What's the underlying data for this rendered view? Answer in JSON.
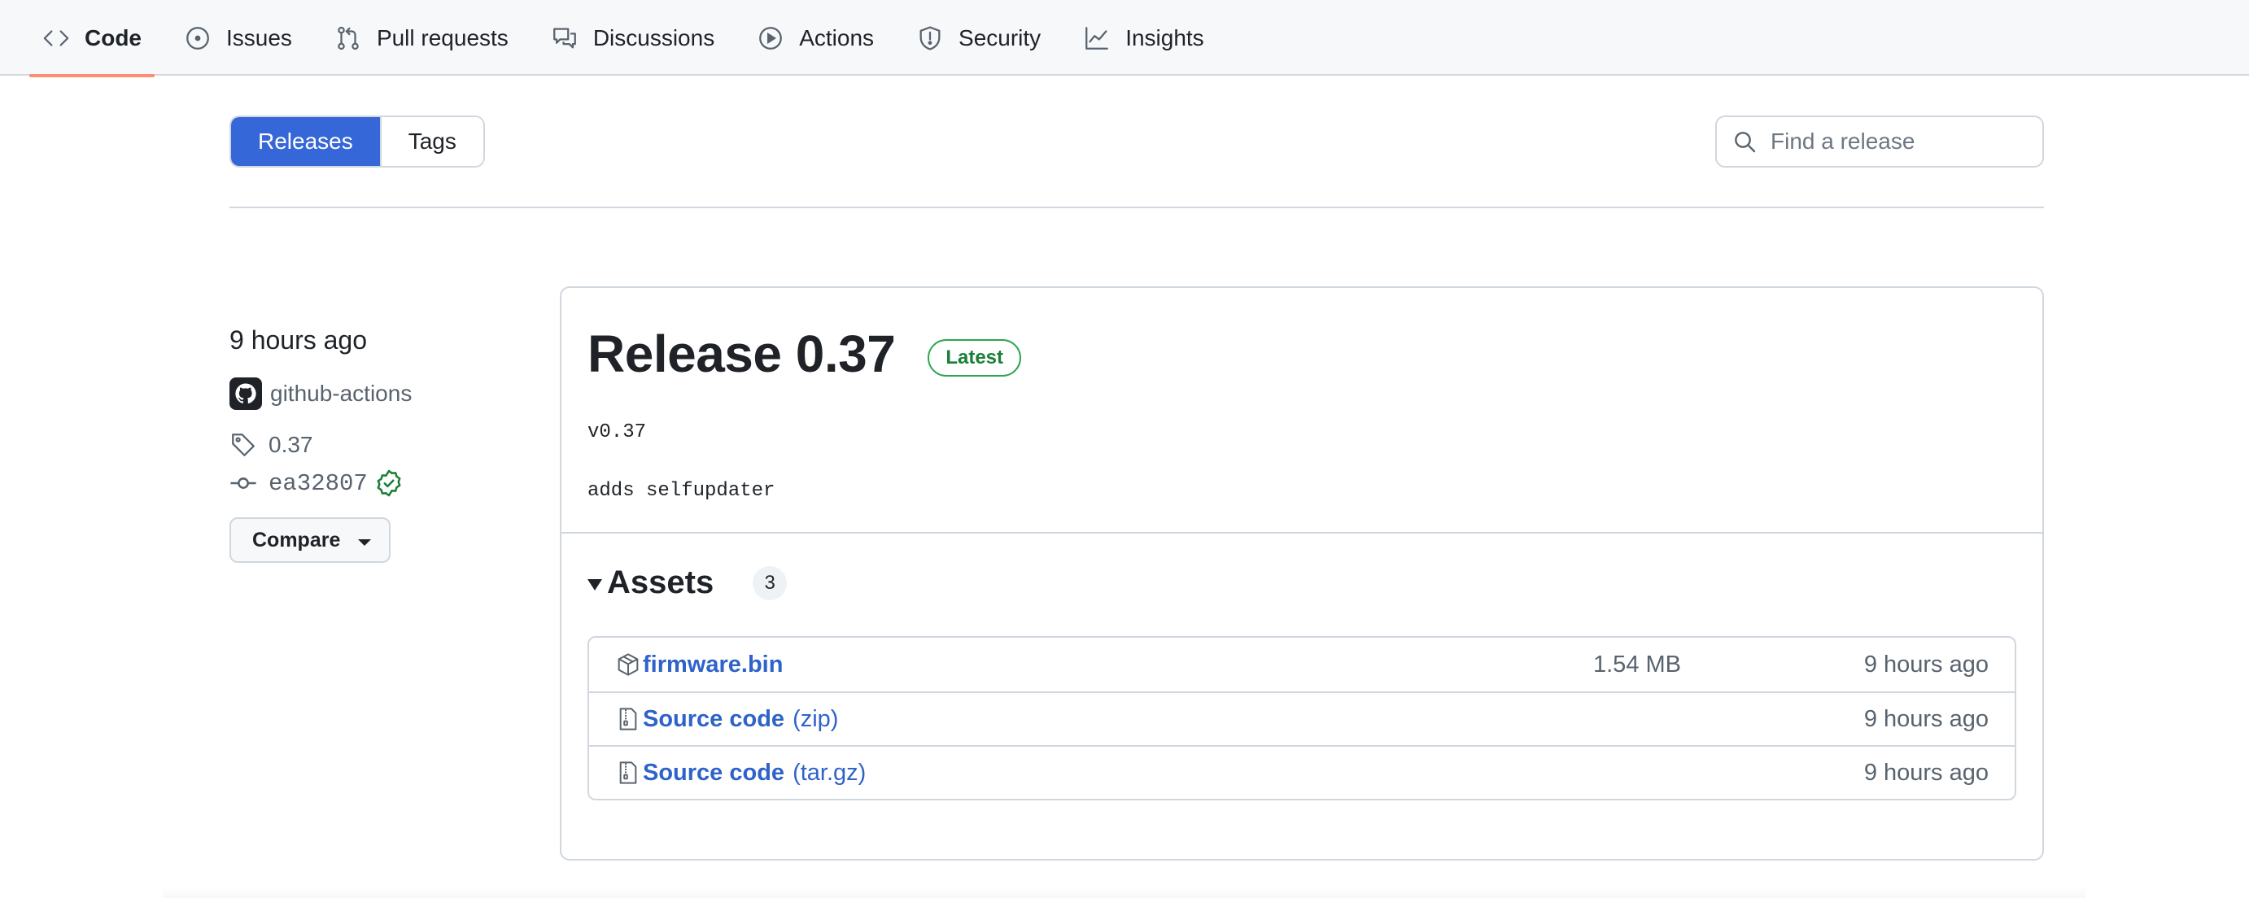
{
  "repo_nav": {
    "tabs": [
      {
        "label": "Code",
        "icon": "code-icon",
        "selected": true
      },
      {
        "label": "Issues",
        "icon": "issue-opened-icon",
        "selected": false
      },
      {
        "label": "Pull requests",
        "icon": "git-pull-request-icon",
        "selected": false
      },
      {
        "label": "Discussions",
        "icon": "comment-discussion-icon",
        "selected": false
      },
      {
        "label": "Actions",
        "icon": "play-icon",
        "selected": false
      },
      {
        "label": "Security",
        "icon": "shield-icon",
        "selected": false
      },
      {
        "label": "Insights",
        "icon": "graph-icon",
        "selected": false
      }
    ],
    "accent": "#fd8c73"
  },
  "subnav": {
    "releases_label": "Releases",
    "tags_label": "Tags",
    "search_placeholder": "Find a release",
    "active_color": "#3667d8"
  },
  "release": {
    "time": "9 hours ago",
    "author": "github-actions",
    "tag": "0.37",
    "commit": "ea32807",
    "compare_label": "Compare",
    "title": "Release 0.37",
    "badge": "Latest",
    "notes": [
      "v0.37",
      "adds selfupdater"
    ],
    "assets_label": "Assets",
    "assets_count": "3",
    "assets": [
      {
        "name": "firmware.bin",
        "suffix": "",
        "size": "1.54 MB",
        "time": "9 hours ago",
        "icon": "package-icon"
      },
      {
        "name": "Source code",
        "suffix": "(zip)",
        "size": "",
        "time": "9 hours ago",
        "icon": "file-zip-icon"
      },
      {
        "name": "Source code",
        "suffix": "(tar.gz)",
        "size": "",
        "time": "9 hours ago",
        "icon": "file-zip-icon"
      }
    ]
  }
}
